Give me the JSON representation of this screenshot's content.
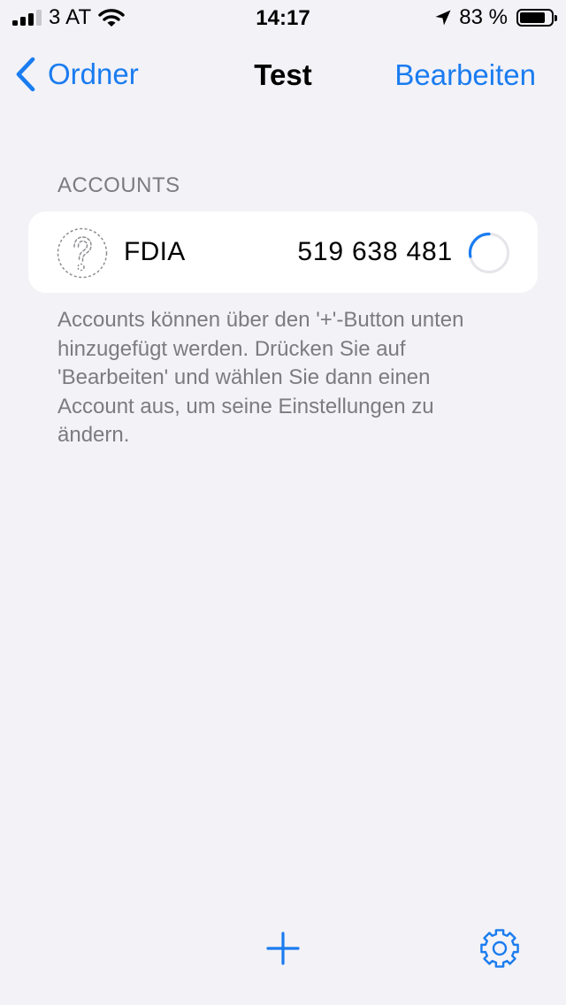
{
  "status_bar": {
    "carrier": "3 AT",
    "time": "14:17",
    "battery_text": "83 %",
    "battery_level": 0.83
  },
  "nav": {
    "back_label": "Ordner",
    "title": "Test",
    "edit_label": "Bearbeiten"
  },
  "accounts_section": {
    "header": "ACCOUNTS",
    "items": [
      {
        "name": "FDIA",
        "code": "519 638 481",
        "icon": "question-mark-icon",
        "time_remaining_fraction": 0.28
      }
    ],
    "footer": "Accounts können über den '+'-Button unten hinzugefügt werden. Drücken Sie auf 'Bearbeiten' und wählen Sie dann einen Account aus, um seine Einstellungen zu ändern."
  },
  "toolbar": {
    "add_icon": "plus-icon",
    "settings_icon": "gear-icon"
  },
  "colors": {
    "accent": "#1a7cf0",
    "background": "#f2f2f7",
    "secondary_text": "#7c7c80"
  }
}
